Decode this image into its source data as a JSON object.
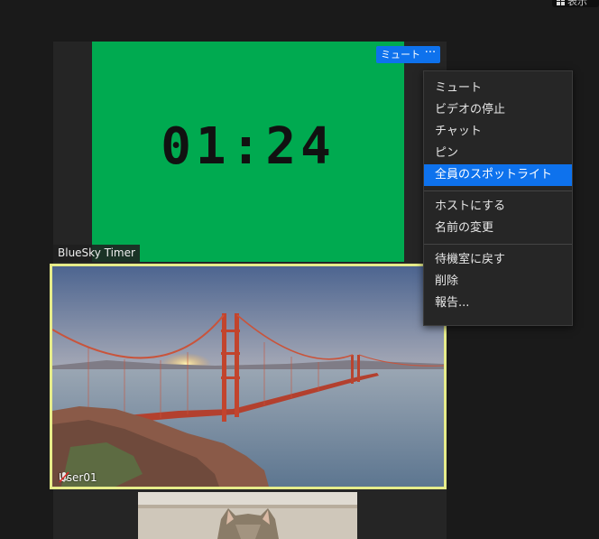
{
  "top_right": {
    "label": "表示"
  },
  "tiles": {
    "timer": {
      "time": "01:24",
      "name": "BlueSky Timer"
    },
    "bridge": {
      "name": "User01"
    }
  },
  "controls": {
    "mute_label": "ミュート",
    "more_label": "···"
  },
  "menu": {
    "group1": [
      "ミュート",
      "ビデオの停止",
      "チャット",
      "ピン",
      "全員のスポットライト"
    ],
    "group2": [
      "ホストにする",
      "名前の変更"
    ],
    "group3": [
      "待機室に戻す",
      "削除",
      "報告..."
    ],
    "highlighted": "全員のスポットライト"
  },
  "colors": {
    "accent": "#0e72ed",
    "timer_bg": "#00aa50",
    "active_speaker_border": "#e6ec8a"
  }
}
